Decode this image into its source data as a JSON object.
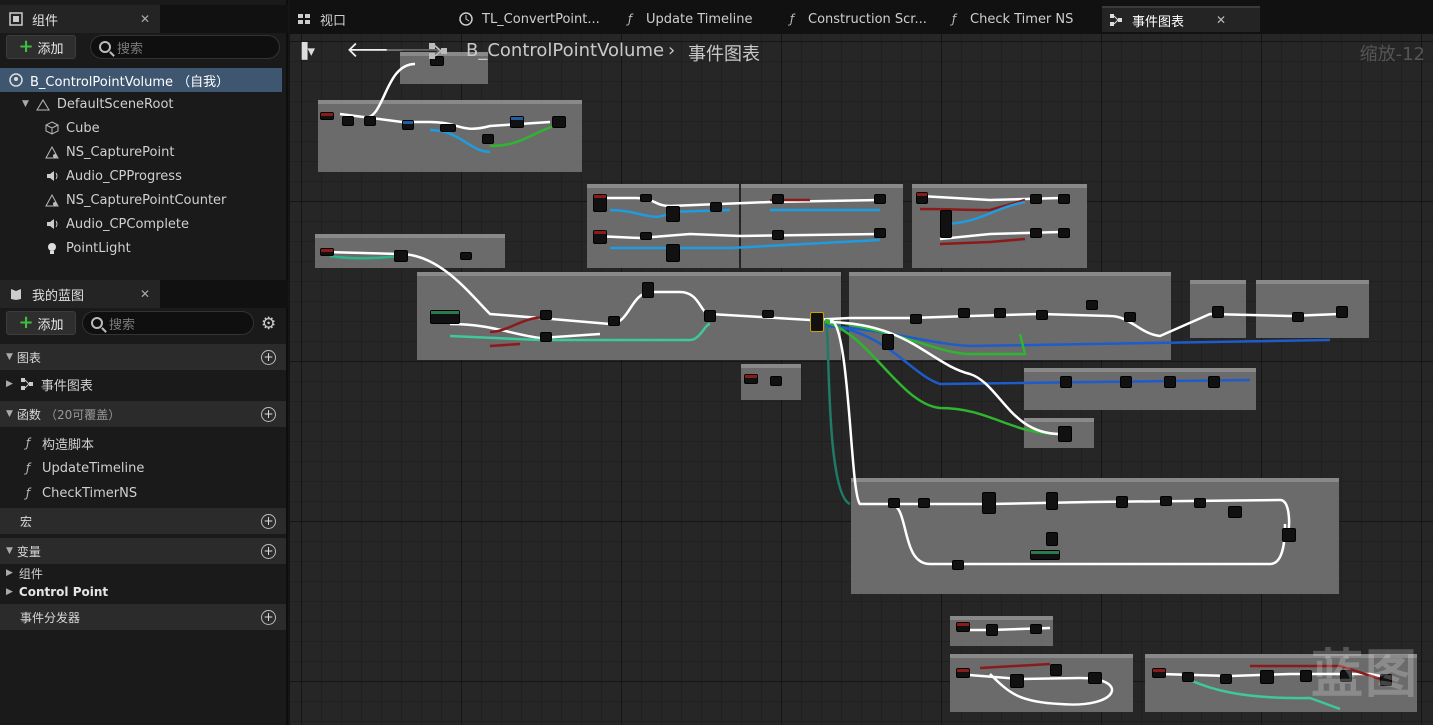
{
  "components_panel": {
    "tab_label": "组件",
    "add_label": "添加",
    "search_placeholder": "搜索",
    "tree": [
      {
        "label": "B_ControlPointVolume （自我）",
        "icon": "actor-icon"
      },
      {
        "label": "DefaultSceneRoot",
        "icon": "scene-root-icon"
      },
      {
        "label": "Cube",
        "icon": "cube-icon"
      },
      {
        "label": "NS_CapturePoint",
        "icon": "niagara-icon"
      },
      {
        "label": "Audio_CPProgress",
        "icon": "speaker-icon"
      },
      {
        "label": "NS_CapturePointCounter",
        "icon": "niagara-icon"
      },
      {
        "label": "Audio_CPComplete",
        "icon": "speaker-icon"
      },
      {
        "label": "PointLight",
        "icon": "lightbulb-icon"
      }
    ]
  },
  "my_blueprint_panel": {
    "tab_label": "我的蓝图",
    "add_label": "添加",
    "search_placeholder": "搜索",
    "sections": {
      "graphs": "图表",
      "event_graph": "事件图表",
      "functions": "函数",
      "functions_note": "（20可覆盖）",
      "function_items": [
        "构造脚本",
        "UpdateTimeline",
        "CheckTimerNS"
      ],
      "macros": "宏",
      "variables": "变量",
      "variable_groups": [
        "组件",
        "Control Point"
      ],
      "event_dispatchers": "事件分发器"
    }
  },
  "top_tabs": [
    {
      "label": "视口",
      "icon": "viewport-icon"
    },
    {
      "label": "TL_ConvertPoint...",
      "icon": "timeline-icon"
    },
    {
      "label": "Update Timeline",
      "icon": "function-icon"
    },
    {
      "label": "Construction Scr...",
      "icon": "function-icon"
    },
    {
      "label": "Check Timer NS",
      "icon": "function-icon"
    },
    {
      "label": "事件图表",
      "icon": "graph-icon",
      "active": true
    }
  ],
  "graph": {
    "breadcrumb_blueprint": "B_ControlPointVolume",
    "breadcrumb_graph": "事件图表",
    "zoom": "缩放-12",
    "watermark": "蓝图"
  },
  "colors": {
    "selection": "#3e5670",
    "exec_wire": "#ffffff",
    "float_wire": "#1f9be0",
    "bool_wire": "#8b1a1a",
    "struct_wire": "#2fb52f",
    "object_wire": "#1e5ccc"
  }
}
